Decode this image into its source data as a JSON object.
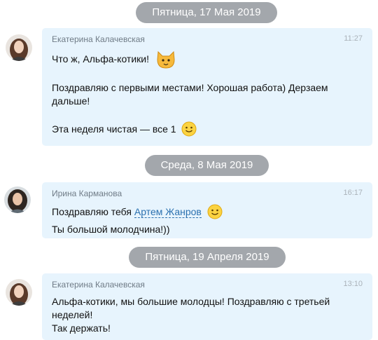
{
  "days": [
    {
      "date": "Пятница, 17 Мая 2019",
      "message": {
        "author": "Екатерина Калачевская",
        "time": "11:27",
        "line1": "Что ж, Альфа-котики!",
        "line2": "Поздравляю с первыми местами! Хорошая работа) Дерзаем",
        "line3": "дальше!",
        "line4": "Эта неделя чистая — все 1",
        "emoji": [
          "cat-emoji",
          "smile-emoji"
        ]
      }
    },
    {
      "date": "Среда, 8 Мая 2019",
      "message": {
        "author": "Ирина Карманова",
        "time": "16:17",
        "line1_prefix": "Поздравляю тебя",
        "mention": "Артем Жанров",
        "line2": "Ты большой молодчина!))",
        "emoji": [
          "smile-emoji"
        ]
      }
    },
    {
      "date": "Пятница, 19 Апреля 2019",
      "message": {
        "author": "Екатерина Калачевская",
        "time": "13:10",
        "line1": "Альфа-котики, мы большие молодцы! Поздравляю с третьей",
        "line2": "неделей!",
        "line3": "Так держать!"
      }
    }
  ],
  "colors": {
    "date_pill": "#a3a7ac",
    "bubble": "#e7f4fd",
    "mention": "#2b71b0"
  }
}
